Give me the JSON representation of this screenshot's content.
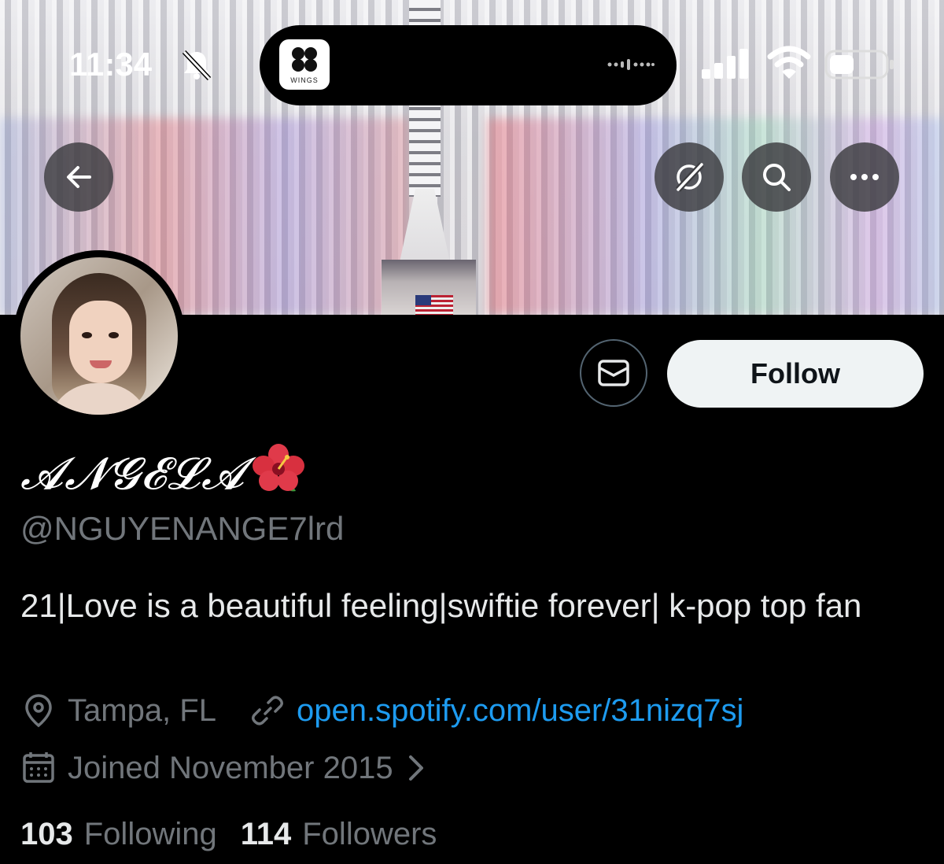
{
  "status_bar": {
    "time": "11:34",
    "silent_icon": "bell-slash-icon",
    "now_playing_app": {
      "label": "WINGS",
      "icon": "album-art-icon"
    },
    "indicators": [
      "cellular-signal-icon",
      "wifi-icon",
      "battery-icon"
    ]
  },
  "banner_actions": {
    "back_icon": "arrow-left-icon",
    "grok_icon": "grok-icon",
    "search_icon": "search-icon",
    "more_icon": "more-horizontal-icon"
  },
  "actions": {
    "message_icon": "envelope-icon",
    "follow_label": "Follow"
  },
  "profile": {
    "display_name": "𝓐𝓝𝓖𝓔𝓛𝓐",
    "display_name_emoji": "hibiscus",
    "handle": "@NGUYENANGE7lrd",
    "bio": "21|Love is a beautiful feeling|swiftie forever| k-pop top fan",
    "location": "Tampa, FL",
    "website": "open.spotify.com/user/31nizq7sj",
    "joined": "Joined November 2015"
  },
  "stats": {
    "following_count": "103",
    "following_label": "Following",
    "followers_count": "114",
    "followers_label": "Followers"
  },
  "colors": {
    "background": "#000000",
    "secondary_text": "#71767b",
    "link": "#1d9bf0",
    "follow_button_bg": "#eff3f4"
  }
}
